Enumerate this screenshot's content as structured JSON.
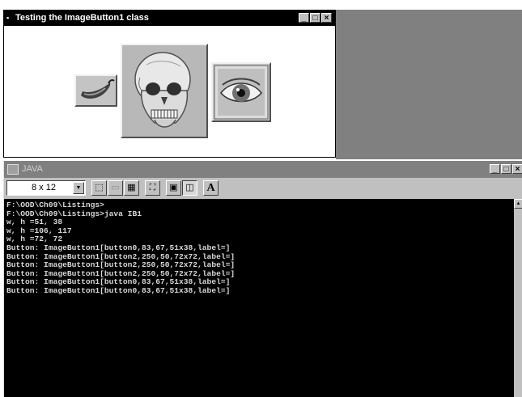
{
  "test_window": {
    "title": "Testing the ImageButton1 class",
    "controls": {
      "minimize": "_",
      "maximize": "□",
      "close": "×"
    },
    "image_buttons": [
      {
        "icon": "chili-pepper-icon"
      },
      {
        "icon": "skull-icon"
      },
      {
        "icon": "eye-icon"
      }
    ]
  },
  "console_window": {
    "title": "JAVA",
    "controls": {
      "minimize": "_",
      "maximize": "□",
      "close": "×"
    },
    "font_size": "8 x 12",
    "toolbar_icons": [
      "mark-icon",
      "copy-icon",
      "paste-icon",
      "fullscreen-icon",
      "properties-icon",
      "background-icon",
      "font-icon"
    ],
    "font_button_label": "A",
    "output_lines": [
      "F:\\OOD\\Ch09\\Listings>",
      "F:\\OOD\\Ch09\\Listings>java IB1",
      "w, h =51, 38",
      "w, h =106, 117",
      "w, h =72, 72",
      "Button: ImageButton1[button0,83,67,51x38,label=]",
      "Button: ImageButton1[button2,250,50,72x72,label=]",
      "Button: ImageButton1[button2,250,50,72x72,label=]",
      "Button: ImageButton1[button2,250,50,72x72,label=]",
      "Button: ImageButton1[button0,83,67,51x38,label=]",
      "Button: ImageButton1[button0,83,67,51x38,label=]"
    ]
  }
}
